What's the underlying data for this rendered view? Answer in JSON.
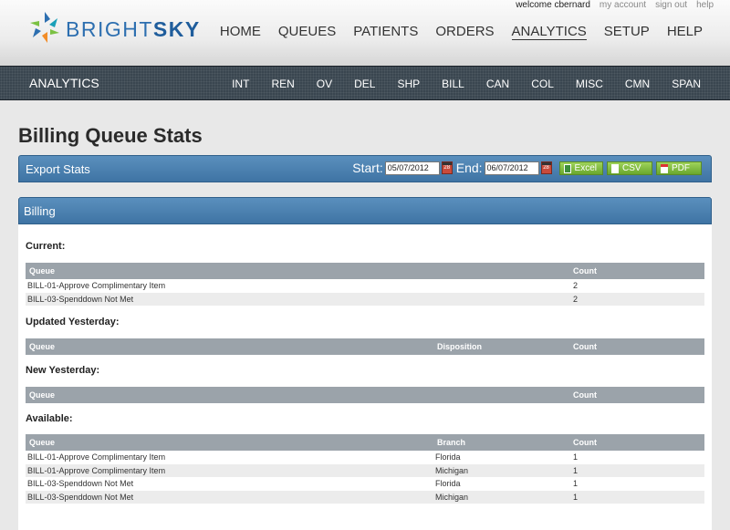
{
  "brand": {
    "name_light": "BRIGHT",
    "name_bold": "SKY",
    "colors": {
      "blue": "#2d6fb0",
      "green": "#7bc143",
      "orange": "#f28c28",
      "teal": "#1aa0b8"
    }
  },
  "user_links": {
    "welcome": "welcome cbernard",
    "account": "my account",
    "signout": "sign out",
    "help": "help"
  },
  "main_nav": [
    {
      "label": "HOME"
    },
    {
      "label": "QUEUES"
    },
    {
      "label": "PATIENTS"
    },
    {
      "label": "ORDERS"
    },
    {
      "label": "ANALYTICS",
      "active": true
    },
    {
      "label": "SETUP"
    },
    {
      "label": "HELP"
    }
  ],
  "sub_nav": {
    "title": "ANALYTICS",
    "items": [
      "INT",
      "REN",
      "OV",
      "DEL",
      "SHP",
      "BILL",
      "CAN",
      "COL",
      "MISC",
      "CMN",
      "SPAN"
    ]
  },
  "page_title": "Billing Queue Stats",
  "export": {
    "label": "Export Stats",
    "start_label": "Start:",
    "start_value": "05/07/2012",
    "end_label": "End:",
    "end_value": "06/07/2012",
    "calendar_day": "28",
    "excel": "Excel",
    "csv": "CSV",
    "pdf": "PDF"
  },
  "billing": {
    "title": "Billing",
    "current": {
      "heading": "Current:",
      "headers": [
        "Queue",
        "Count"
      ],
      "rows": [
        [
          "BILL-01-Approve Complimentary Item",
          "2"
        ],
        [
          "BILL-03-Spenddown Not Met",
          "2"
        ]
      ]
    },
    "updated": {
      "heading": "Updated Yesterday:",
      "headers": [
        "Queue",
        "Disposition",
        "Count"
      ]
    },
    "new": {
      "heading": "New Yesterday:",
      "headers": [
        "Queue",
        "Count"
      ]
    },
    "available": {
      "heading": "Available:",
      "headers": [
        "Queue",
        "Branch",
        "Count"
      ],
      "rows": [
        [
          "BILL-01-Approve Complimentary Item",
          "Florida",
          "1"
        ],
        [
          "BILL-01-Approve Complimentary Item",
          "Michigan",
          "1"
        ],
        [
          "BILL-03-Spenddown Not Met",
          "Florida",
          "1"
        ],
        [
          "BILL-03-Spenddown Not Met",
          "Michigan",
          "1"
        ]
      ]
    }
  }
}
